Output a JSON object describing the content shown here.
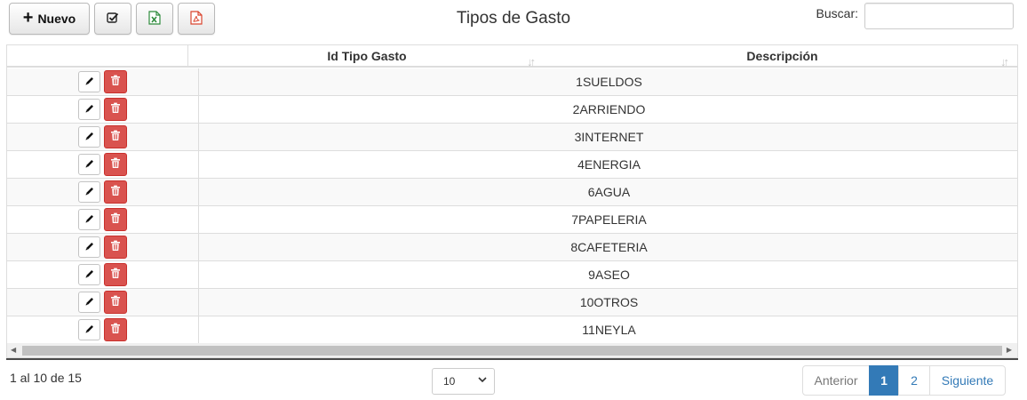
{
  "toolbar": {
    "new_label": "Nuevo",
    "icons": [
      "plus-icon",
      "checklist-icon",
      "excel-icon",
      "pdf-icon"
    ],
    "excel_color": "#2e8b3c",
    "pdf_color": "#d9452f"
  },
  "title": "Tipos de Gasto",
  "search": {
    "label": "Buscar:",
    "value": "",
    "placeholder": ""
  },
  "table": {
    "headers": {
      "actions": "",
      "id": "Id Tipo Gasto",
      "description": "Descripción"
    },
    "rows": [
      {
        "id": "1",
        "description": "SUELDOS"
      },
      {
        "id": "2",
        "description": "ARRIENDO"
      },
      {
        "id": "3",
        "description": "INTERNET"
      },
      {
        "id": "4",
        "description": "ENERGIA"
      },
      {
        "id": "6",
        "description": "AGUA"
      },
      {
        "id": "7",
        "description": "PAPELERIA"
      },
      {
        "id": "8",
        "description": "CAFETERIA"
      },
      {
        "id": "9",
        "description": "ASEO"
      },
      {
        "id": "10",
        "description": "OTROS"
      },
      {
        "id": "11",
        "description": "NEYLA"
      }
    ]
  },
  "footer": {
    "info": "1 al 10 de 15",
    "page_size": "10",
    "pagination": {
      "prev": "Anterior",
      "pages": [
        "1",
        "2"
      ],
      "active": "1",
      "next": "Siguiente"
    }
  },
  "colors": {
    "accent": "#337ab7",
    "danger": "#d9534f",
    "stripe": "#f9f9f9",
    "border": "#dddddd"
  }
}
